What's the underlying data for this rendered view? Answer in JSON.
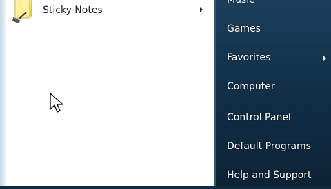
{
  "programs": [
    {
      "label": "Sticky Notes",
      "icon": "sticky-notes-icon",
      "has_submenu": true
    }
  ],
  "places": [
    {
      "label": "Music",
      "has_submenu": false
    },
    {
      "label": "Games",
      "has_submenu": false
    },
    {
      "label": "Favorites",
      "has_submenu": true
    },
    {
      "label": "Computer",
      "has_submenu": false
    },
    {
      "label": "Control Panel",
      "has_submenu": false
    },
    {
      "label": "Default Programs",
      "has_submenu": false
    },
    {
      "label": "Help and Support",
      "has_submenu": false
    }
  ],
  "colors": {
    "right_pane": "#123049",
    "left_pane": "#ffffff",
    "text_dark": "#1e1e1e",
    "text_light": "#ffffff"
  }
}
